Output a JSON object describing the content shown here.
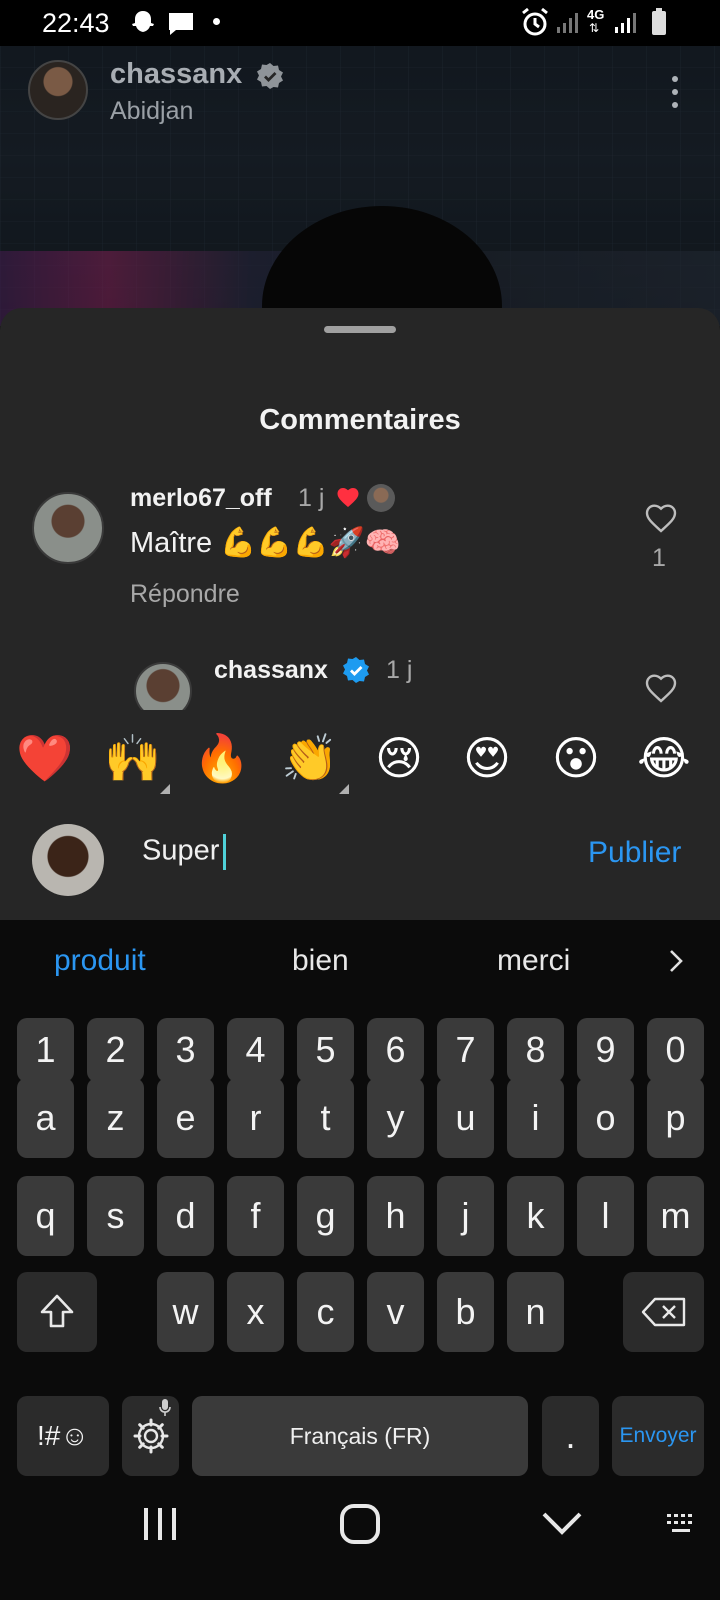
{
  "status_bar": {
    "time": "22:43",
    "network_label": "4G",
    "icons": [
      "snapchat-icon",
      "message-icon",
      "dot-icon",
      "alarm-icon",
      "signal-icon",
      "signal-4g-icon",
      "battery-icon"
    ]
  },
  "post": {
    "author": "chassanx",
    "verified": true,
    "location": "Abidjan"
  },
  "comments_sheet": {
    "title": "Commentaires",
    "comments": [
      {
        "user": "merlo67_off",
        "time": "1 j",
        "text": "Maître 💪💪💪🚀🧠",
        "reply_label": "Répondre",
        "like_count": "1",
        "liked_by_author": true
      },
      {
        "user": "chassanx",
        "verified": true,
        "time": "1 j"
      }
    ]
  },
  "emoji_bar": [
    "❤️",
    "🙌",
    "🔥",
    "👏",
    "😢",
    "😍",
    "😮",
    "😂"
  ],
  "composer": {
    "value": "Super",
    "publish_label": "Publier"
  },
  "keyboard": {
    "suggestions": [
      "produit",
      "bien",
      "merci"
    ],
    "row_numbers": [
      "1",
      "2",
      "3",
      "4",
      "5",
      "6",
      "7",
      "8",
      "9",
      "0"
    ],
    "row_1": [
      "a",
      "z",
      "e",
      "r",
      "t",
      "y",
      "u",
      "i",
      "o",
      "p"
    ],
    "row_2": [
      "q",
      "s",
      "d",
      "f",
      "g",
      "h",
      "j",
      "k",
      "l",
      "m"
    ],
    "row_3": [
      "w",
      "x",
      "c",
      "v",
      "b",
      "n"
    ],
    "symbols_label": "!#☺",
    "space_label": "Français (FR)",
    "period_label": ".",
    "send_label": "Envoyer"
  },
  "colors": {
    "accent": "#2b96f1",
    "sheet_bg": "#262626",
    "key_bg": "#3a3a3a",
    "like_red": "#ff3040",
    "verified_blue": "#1d9bf0"
  }
}
